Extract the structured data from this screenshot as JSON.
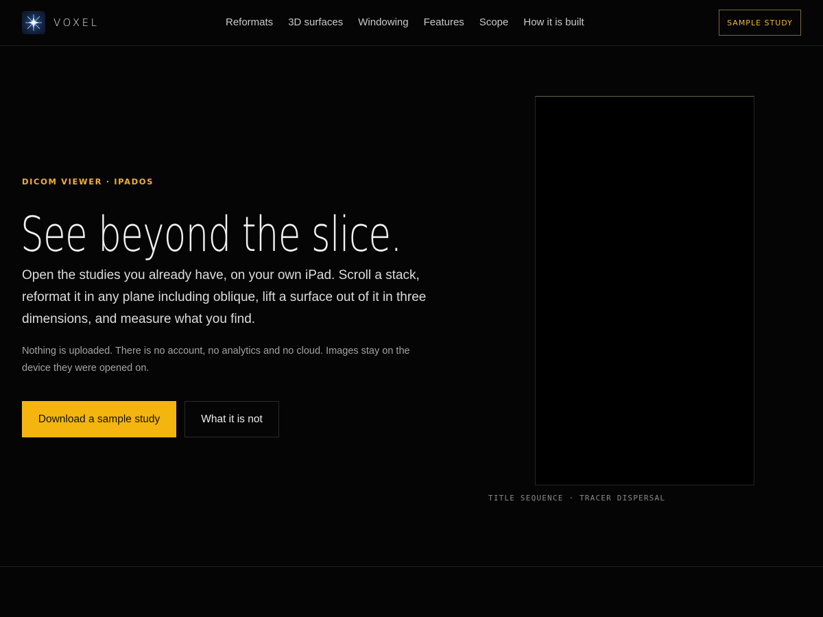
{
  "brand": {
    "name": "VOXEL",
    "logo_icon": "voxel-star-logo"
  },
  "nav": {
    "items": [
      {
        "label": "Reformats"
      },
      {
        "label": "3D surfaces"
      },
      {
        "label": "Windowing"
      },
      {
        "label": "Features"
      },
      {
        "label": "Scope"
      },
      {
        "label": "How it is built"
      }
    ],
    "cta_label": "SAMPLE STUDY"
  },
  "hero": {
    "eyebrow": "DICOM VIEWER · IPADOS",
    "headline": "See beyond the slice.",
    "lead": "Open the studies you already have, on your own iPad. Scroll a stack, reformat it in any plane including oblique, lift a surface out of it in three dimensions, and measure what you find.",
    "note": "Nothing is uploaded. There is no account, no analytics and no cloud. Images stay on the device they were opened on.",
    "primary_button": "Download a sample study",
    "secondary_button": "What it is not"
  },
  "media": {
    "caption": "TITLE SEQUENCE · TRACER DISPERSAL"
  },
  "colors": {
    "accent": "#f5b50f",
    "background": "#050505",
    "nav_cta_border": "#7a6a45"
  }
}
